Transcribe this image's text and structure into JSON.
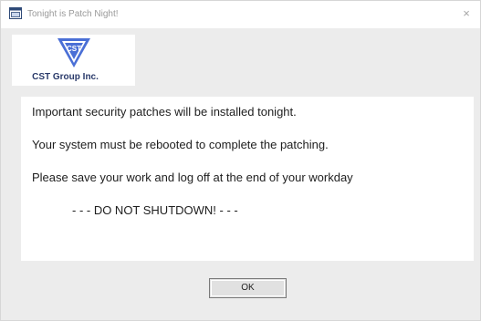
{
  "window": {
    "title": "Tonight is Patch Night!",
    "title_icon": "dialog-window-icon",
    "close_symbol": "×"
  },
  "logo": {
    "company_name": "CST Group Inc.",
    "brand_color": "#4a6fd6"
  },
  "message": {
    "line1": "Important security patches will be installed tonight.",
    "line2": "Your system must be rebooted to complete the patching.",
    "line3": "Please save your work and log off at the end of your workday",
    "line4": "- - - DO NOT SHUTDOWN! - - -"
  },
  "buttons": {
    "ok_label": "OK"
  }
}
